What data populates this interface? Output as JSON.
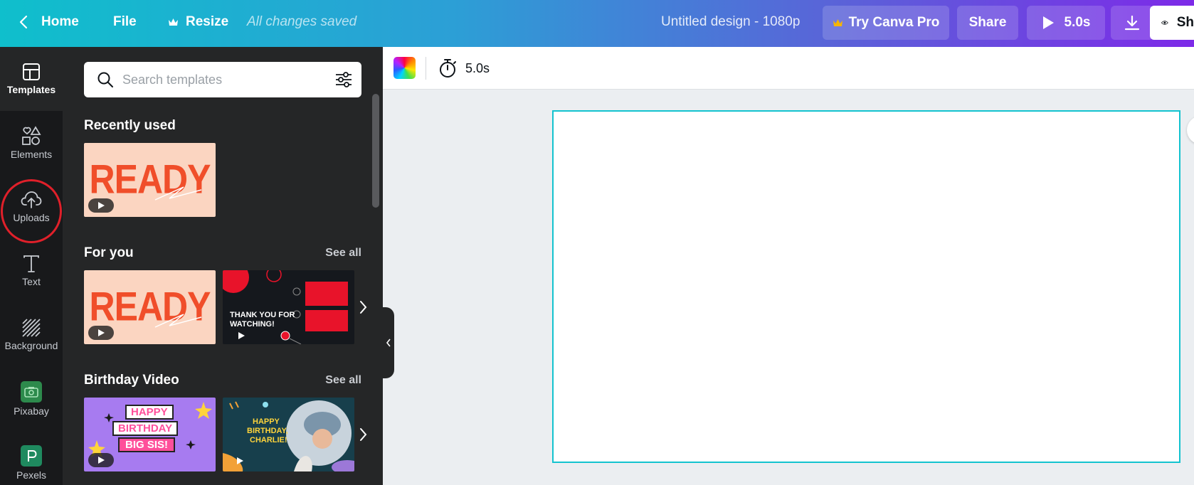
{
  "topbar": {
    "home": "Home",
    "file": "File",
    "resize": "Resize",
    "saved_status": "All changes saved",
    "design_title": "Untitled design - 1080p",
    "try_pro": "Try Canva Pro",
    "share": "Share",
    "play_duration": "5.0s",
    "preview_label_partial": "Sh"
  },
  "rail": {
    "items": [
      {
        "label": "Templates",
        "icon": "templates-icon"
      },
      {
        "label": "Elements",
        "icon": "elements-icon"
      },
      {
        "label": "Uploads",
        "icon": "cloud-upload-icon"
      },
      {
        "label": "Text",
        "icon": "text-icon"
      },
      {
        "label": "Background",
        "icon": "background-icon"
      },
      {
        "label": "Pixabay",
        "icon": "pixabay-icon"
      },
      {
        "label": "Pexels",
        "icon": "pexels-icon"
      }
    ]
  },
  "panel": {
    "search_placeholder": "Search templates",
    "sections": [
      {
        "title": "Recently used"
      },
      {
        "title": "For you",
        "see_all": "See all"
      },
      {
        "title": "Birthday Video",
        "see_all": "See all"
      }
    ],
    "thumbs": {
      "ready": "READY",
      "thankyou_line1": "THANK YOU FOR",
      "thankyou_line2": "WATCHING!",
      "bday1_l1": "HAPPY",
      "bday1_l2": "BIRTHDAY",
      "bday1_l3": "BIG SIS!",
      "bday2_l1": "HAPPY",
      "bday2_l2": "BIRTHDAY,",
      "bday2_l3": "CHARLIE!"
    }
  },
  "canvas_toolbar": {
    "duration": "5.0s"
  },
  "colors": {
    "accent": "#13c3cf",
    "ready_bg": "#fbd5c1",
    "ready_text": "#f04e2a",
    "highlight_circle": "#e0202a"
  }
}
